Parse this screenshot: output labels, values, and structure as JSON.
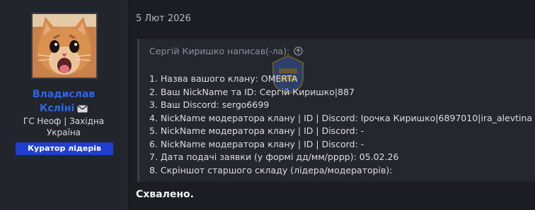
{
  "user": {
    "name_line1": "Владислав",
    "name_line2": "Ксліні",
    "title_line1": "ГС Неоф | Західна",
    "title_line2": "Україна",
    "badge": "Куратор лідерів",
    "avatar_icon": "kitten-avatar",
    "mail_icon": "envelope-icon"
  },
  "post": {
    "date": "5 Лют 2026",
    "quote": {
      "author_text": "Сергій Киришко написав(-ла):",
      "jump_icon": "arrow-up-circle-icon",
      "lines": [
        "1. Назва вашого клану: OMERTA",
        "2. Ваш NickName та ID: Сергій Киришко|887",
        "3. Ваш Discord: sergo6699",
        "4. NickName модератора клану | ID | Discord: Ірочка Киришко|6897010|ira_alevtina",
        "5. NickName модератора клану | ID | Discord: -",
        "6. NickName модератора клану | ID | Discord: -",
        "7. Дата подачі заявки (у формі дд/мм/рррр): 05.02.26",
        "8. Скріншот старшого складу (лідера/модераторів):"
      ]
    },
    "reply": "Схвалено."
  },
  "colors": {
    "username": "#2f67e0",
    "badge_bg": "#1f3fd0",
    "background": "#1b1d22",
    "quote_bg": "#24272d"
  }
}
